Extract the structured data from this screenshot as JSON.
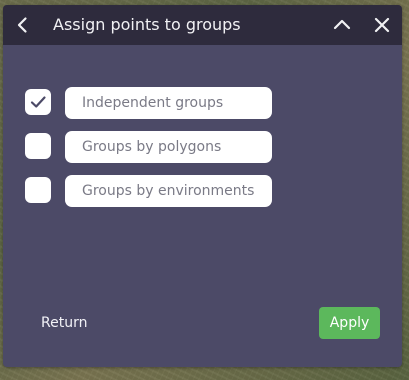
{
  "dialog": {
    "title": "Assign points to groups",
    "icons": {
      "back": "chevron-left-icon",
      "collapse": "chevron-up-icon",
      "close": "close-icon"
    },
    "options": [
      {
        "label": "Independent groups",
        "checked": true
      },
      {
        "label": "Groups by polygons",
        "checked": false
      },
      {
        "label": "Groups by environments",
        "checked": false
      }
    ],
    "footer": {
      "return_label": "Return",
      "apply_label": "Apply"
    },
    "colors": {
      "header": "#2e2b3d",
      "panel": "#4c4a67",
      "apply": "#5cb85c",
      "text": "#f1f1f4"
    }
  }
}
